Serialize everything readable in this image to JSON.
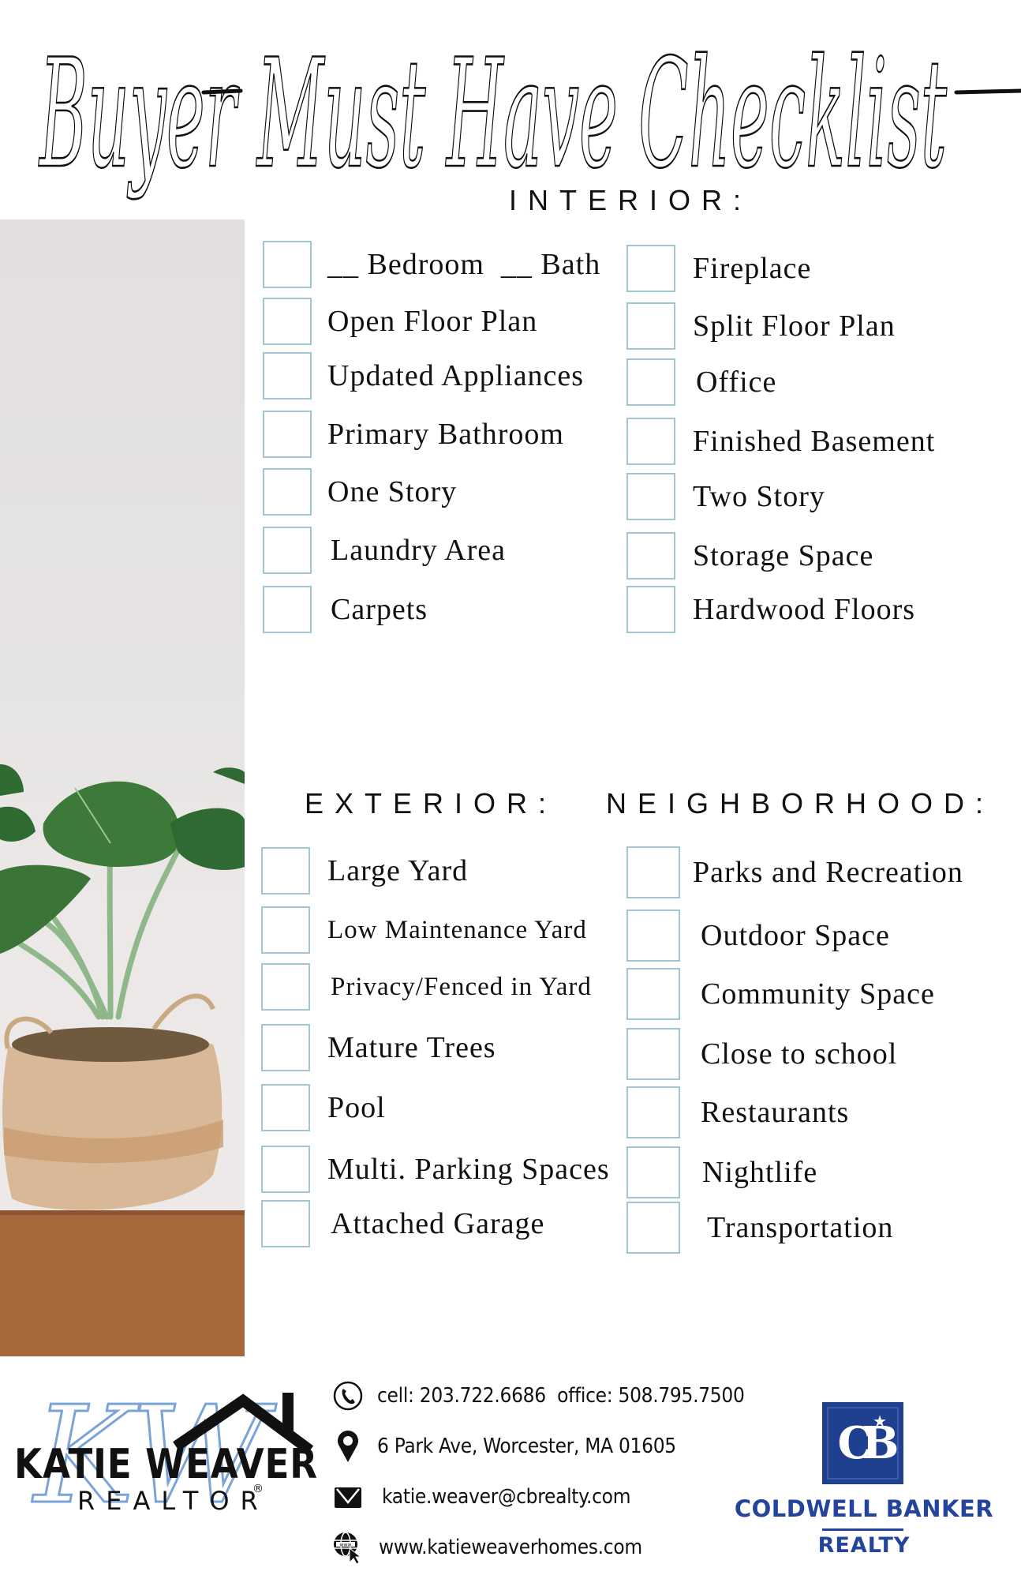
{
  "title": {
    "words": [
      "Buyer",
      "Must",
      "Have",
      "Checklist"
    ],
    "text": "Buyer Must Have Checklist"
  },
  "sections": {
    "interior": {
      "heading": "INTERIOR:",
      "left": [
        "__ Bedroom  __ Bath",
        "Open Floor Plan",
        "Updated Appliances",
        "Primary Bathroom",
        "One Story",
        "Laundry Area",
        "Carpets"
      ],
      "right": [
        "Fireplace",
        "Split Floor Plan",
        "Office",
        "Finished Basement",
        "Two Story",
        "Storage Space",
        "Hardwood Floors"
      ]
    },
    "exterior": {
      "heading": "EXTERIOR:",
      "items": [
        "Large Yard",
        "Low Maintenance Yard",
        "Privacy/Fenced in Yard",
        "Mature Trees",
        "Pool",
        "Multi. Parking Spaces",
        "Attached Garage"
      ]
    },
    "neighborhood": {
      "heading": "NEIGHBORHOOD:",
      "items": [
        "Parks and Recreation",
        "Outdoor Space",
        "Community Space",
        "Close to school",
        "Restaurants",
        "Nightlife",
        "Transportation"
      ]
    }
  },
  "photo": {
    "subject": "potted plant in woven basket",
    "icon": "plant-photo"
  },
  "footer": {
    "agent_logo": {
      "name": "KATIE WEAVER",
      "subtitle": "REALTOR",
      "registered_mark": "®",
      "monogram": "KW"
    },
    "contacts": [
      {
        "icon": "phone-icon",
        "text": "cell: 203.722.6686  office: 508.795.7500"
      },
      {
        "icon": "map-pin-icon",
        "text": "6 Park Ave, Worcester, MA 01605"
      },
      {
        "icon": "envelope-icon",
        "text": "katie.weaver@cbrealty.com"
      },
      {
        "icon": "globe-cursor-icon",
        "text": "www.katieweaverhomes.com"
      }
    ],
    "brokerage_logo": {
      "monogram": "CB",
      "name": "COLDWELL BANKER",
      "subtitle": "REALTY"
    }
  },
  "colors": {
    "checkbox_border": "#a3c7d2",
    "text": "#111111",
    "kw_script": "#7aa3d6",
    "coldwell_blue": "#1f3f8f"
  }
}
